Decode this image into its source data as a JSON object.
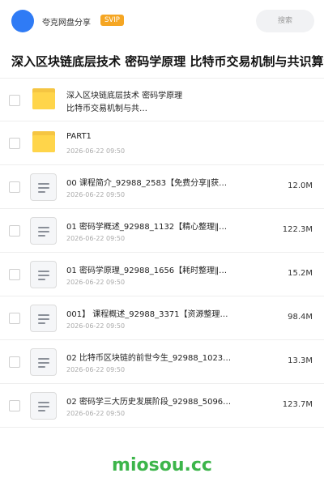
{
  "header": {
    "brand": "夸克网盘分享",
    "badge": "SVIP",
    "search_placeholder": "搜索",
    "accent": "#2f7bf5",
    "badge_color": "#f5a623"
  },
  "title": "深入区块链底层技术 密码学原理 比特币交易机制与共识算法",
  "files": [
    {
      "type": "folder",
      "icon": "folder-icon",
      "name_line1": "深入区块链底层技术 密码学原理",
      "name_line2": "比特币交易机制与共…",
      "date": "2026-06-22 09:50",
      "size": ""
    },
    {
      "type": "folder",
      "icon": "folder-icon",
      "name": "PART1",
      "date": "2026-06-22 09:50",
      "size": ""
    },
    {
      "type": "doc",
      "icon": "document-icon",
      "name": "00 课程简介_92988_2583【免费分享‖获…",
      "date": "2026-06-22 09:50",
      "size": "12.0M"
    },
    {
      "type": "doc",
      "icon": "document-icon",
      "name": "01 密码学概述_92988_1132【精心整理‖…",
      "date": "2026-06-22 09:50",
      "size": "122.3M"
    },
    {
      "type": "doc",
      "icon": "document-icon",
      "name": "01 密码学原理_92988_1656【耗时整理‖…",
      "date": "2026-06-22 09:50",
      "size": "15.2M"
    },
    {
      "type": "doc",
      "icon": "document-icon",
      "name": "001】 课程概述_92988_3371【资源整理…",
      "date": "2026-06-22 09:50",
      "size": "98.4M"
    },
    {
      "type": "doc",
      "icon": "document-icon",
      "name": "02 比特币区块链的前世今生_92988_1023…",
      "date": "2026-06-22 09:50",
      "size": "13.3M"
    },
    {
      "type": "doc",
      "icon": "document-icon",
      "name": "02 密码学三大历史发展阶段_92988_5096…",
      "date": "2026-06-22 09:50",
      "size": "123.7M"
    }
  ],
  "watermark": "miosou.cc"
}
